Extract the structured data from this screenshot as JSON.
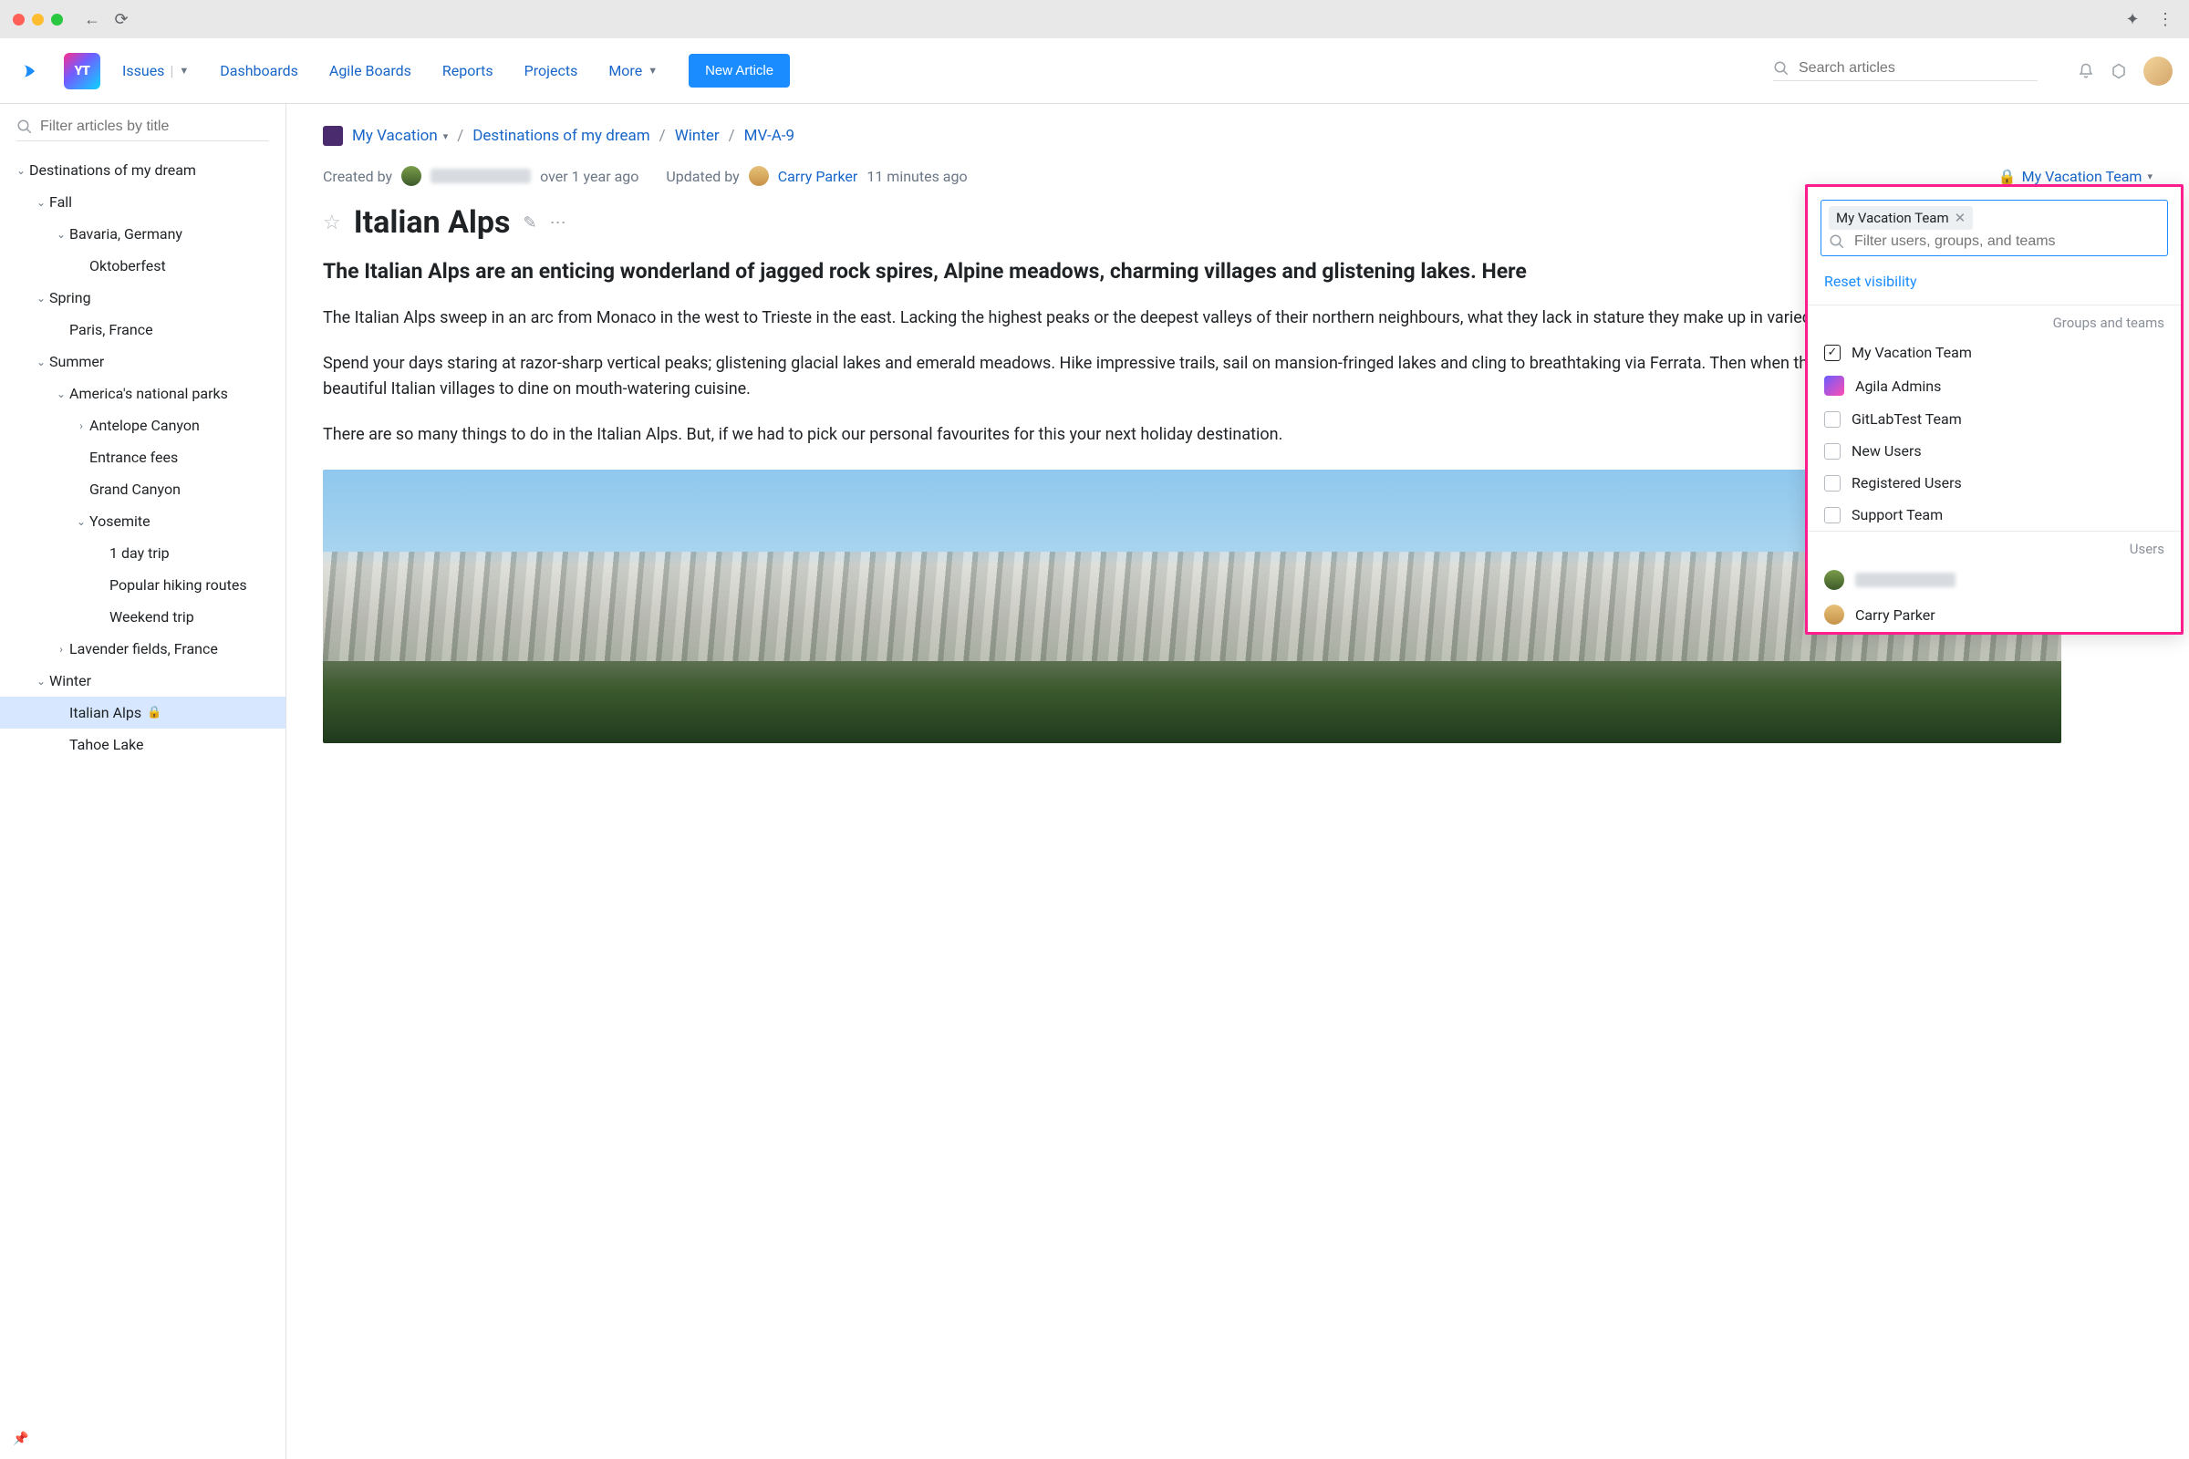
{
  "nav": {
    "issues": "Issues",
    "dashboards": "Dashboards",
    "agile": "Agile Boards",
    "reports": "Reports",
    "projects": "Projects",
    "more": "More",
    "new_article": "New Article",
    "search_placeholder": "Search articles",
    "logo": "YT"
  },
  "sidebar": {
    "filter_placeholder": "Filter articles by title",
    "root": "Destinations of my dream",
    "fall": "Fall",
    "bavaria": "Bavaria, Germany",
    "oktoberfest": "Oktoberfest",
    "spring": "Spring",
    "paris": "Paris, France",
    "summer": "Summer",
    "parks": "America's national parks",
    "antelope": "Antelope Canyon",
    "entrance": "Entrance fees",
    "grand": "Grand Canyon",
    "yosemite": "Yosemite",
    "day1": "1 day trip",
    "hiking": "Popular hiking routes",
    "weekend": "Weekend trip",
    "lavender": "Lavender fields, France",
    "winter": "Winter",
    "italian": "Italian Alps",
    "tahoe": "Tahoe Lake"
  },
  "breadcrumb": {
    "project": "My Vacation",
    "l1": "Destinations of my dream",
    "l2": "Winter",
    "id": "MV-A-9"
  },
  "meta": {
    "created_by_label": "Created by",
    "created_ago": "over 1 year ago",
    "updated_by_label": "Updated by",
    "updated_user": "Carry Parker",
    "updated_ago": "11 minutes ago",
    "visibility": "My Vacation Team"
  },
  "article": {
    "title": "Italian Alps",
    "subtitle": "The Italian Alps are an enticing wonderland of jagged rock spires, Alpine meadows, charming villages and glistening lakes. Here",
    "p1": "The Italian Alps sweep in an arc from Monaco in the west to Trieste in the east. Lacking the highest peaks or the deepest valleys of their northern neighbours, what they lack in stature they make up in varied and beautiful scenery.",
    "p2": "Spend your days staring at razor-sharp vertical peaks; glistening glacial lakes and emerald meadows. Hike impressive trails, sail on mansion-fringed lakes and cling to breathtaking via Ferrata. Then when the sun dies saunter through beautiful Italian villages to dine on mouth-watering cuisine.",
    "p3": "There are so many things to do in the Italian Alps. But, if we had to pick our personal favourites for this your next holiday destination."
  },
  "popover": {
    "token": "My Vacation Team",
    "filter_placeholder": "Filter users, groups, and teams",
    "reset": "Reset visibility",
    "groups_header": "Groups and teams",
    "users_header": "Users",
    "g1": "My Vacation Team",
    "g2": "Agila Admins",
    "g3": "GitLabTest Team",
    "g4": "New Users",
    "g5": "Registered Users",
    "g6": "Support Team",
    "u2": "Carry Parker"
  }
}
